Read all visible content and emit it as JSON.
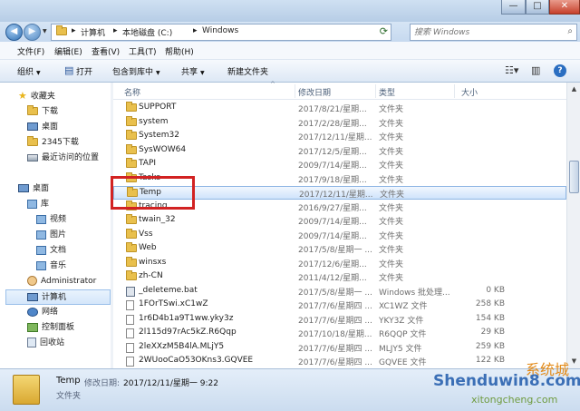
{
  "window": {
    "min_glyph": "—",
    "max_glyph": "□",
    "close_glyph": "✕"
  },
  "address": {
    "crumbs": [
      "计算机",
      "本地磁盘 (C:)",
      "Windows"
    ],
    "sep": "▸"
  },
  "search": {
    "placeholder": "搜索 Windows"
  },
  "menubar": [
    "文件(F)",
    "编辑(E)",
    "查看(V)",
    "工具(T)",
    "帮助(H)"
  ],
  "toolbar": {
    "organize": "组织",
    "open": "打开",
    "include": "包含到库中",
    "share": "共享",
    "newfolder": "新建文件夹"
  },
  "sidebar": {
    "favorites": "收藏夹",
    "download": "下载",
    "desktop_fav": "桌面",
    "dl2345": "2345下载",
    "recent": "最近访问的位置",
    "desktop": "桌面",
    "library": "库",
    "video": "视频",
    "pictures": "图片",
    "documents": "文档",
    "music": "音乐",
    "admin": "Administrator",
    "computer": "计算机",
    "network": "网络",
    "control": "控制面板",
    "recycle": "回收站"
  },
  "columns": {
    "name": "名称",
    "date": "修改日期",
    "type": "类型",
    "size": "大小"
  },
  "rows": [
    {
      "name": "SUPPORT",
      "date": "2017/8/21/星期...",
      "type": "文件夹",
      "size": ""
    },
    {
      "name": "system",
      "date": "2017/2/28/星期...",
      "type": "文件夹",
      "size": ""
    },
    {
      "name": "System32",
      "date": "2017/12/11/星期...",
      "type": "文件夹",
      "size": ""
    },
    {
      "name": "SysWOW64",
      "date": "2017/12/5/星期...",
      "type": "文件夹",
      "size": ""
    },
    {
      "name": "TAPI",
      "date": "2009/7/14/星期...",
      "type": "文件夹",
      "size": ""
    },
    {
      "name": "Tasks",
      "date": "2017/9/18/星期...",
      "type": "文件夹",
      "size": ""
    },
    {
      "name": "Temp",
      "date": "2017/12/11/星期...",
      "type": "文件夹",
      "size": ""
    },
    {
      "name": "tracing",
      "date": "2016/9/27/星期...",
      "type": "文件夹",
      "size": ""
    },
    {
      "name": "twain_32",
      "date": "2009/7/14/星期...",
      "type": "文件夹",
      "size": ""
    },
    {
      "name": "Vss",
      "date": "2009/7/14/星期...",
      "type": "文件夹",
      "size": ""
    },
    {
      "name": "Web",
      "date": "2017/5/8/星期一 ...",
      "type": "文件夹",
      "size": ""
    },
    {
      "name": "winsxs",
      "date": "2017/12/6/星期...",
      "type": "文件夹",
      "size": ""
    },
    {
      "name": "zh-CN",
      "date": "2011/4/12/星期...",
      "type": "文件夹",
      "size": ""
    },
    {
      "name": "_deleteme.bat",
      "date": "2017/5/8/星期一 ...",
      "type": "Windows 批处理...",
      "size": "0 KB"
    },
    {
      "name": "1FOrTSwi.xC1wZ",
      "date": "2017/7/6/星期四 ...",
      "type": "XC1WZ 文件",
      "size": "258 KB"
    },
    {
      "name": "1r6D4b1a9T1ww.yky3z",
      "date": "2017/7/6/星期四 ...",
      "type": "YKY3Z 文件",
      "size": "154 KB"
    },
    {
      "name": "2l115d97rAc5kZ.R6Qqp",
      "date": "2017/10/18/星期...",
      "type": "R6QQP 文件",
      "size": "29 KB"
    },
    {
      "name": "2leXXzM5B4lA.MLjY5",
      "date": "2017/7/6/星期四 ...",
      "type": "MLJY5 文件",
      "size": "259 KB"
    },
    {
      "name": "2WUooCaO53OKns3.GQVEE",
      "date": "2017/7/6/星期四 ...",
      "type": "GQVEE 文件",
      "size": "122 KB"
    }
  ],
  "selected_index": 6,
  "status": {
    "name": "Temp",
    "mod_label": "修改日期:",
    "mod_value": "2017/12/11/星期一 9:22",
    "type": "文件夹"
  },
  "watermark": {
    "text1": "Shenduwin8.com",
    "text2": "xitongcheng.com",
    "logo": "系统城"
  }
}
